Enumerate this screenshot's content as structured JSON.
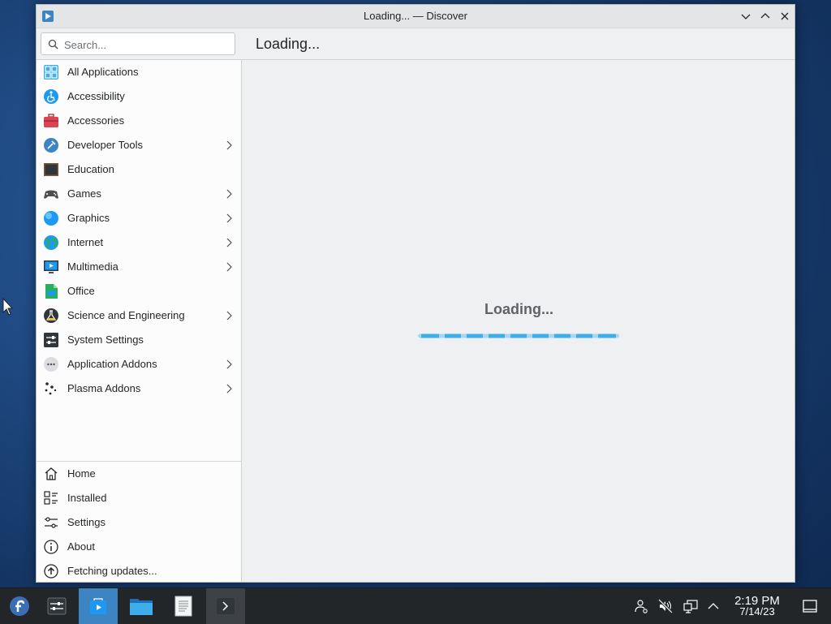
{
  "window": {
    "title": "Loading... — Discover"
  },
  "search": {
    "placeholder": "Search..."
  },
  "header": {
    "page_title": "Loading..."
  },
  "sidebar": {
    "categories": [
      {
        "label": "All Applications",
        "icon": "all-applications-icon",
        "submenu": false
      },
      {
        "label": "Accessibility",
        "icon": "accessibility-icon",
        "submenu": false
      },
      {
        "label": "Accessories",
        "icon": "accessories-icon",
        "submenu": false
      },
      {
        "label": "Developer Tools",
        "icon": "developer-tools-icon",
        "submenu": true
      },
      {
        "label": "Education",
        "icon": "education-icon",
        "submenu": false
      },
      {
        "label": "Games",
        "icon": "games-icon",
        "submenu": true
      },
      {
        "label": "Graphics",
        "icon": "graphics-icon",
        "submenu": true
      },
      {
        "label": "Internet",
        "icon": "internet-icon",
        "submenu": true
      },
      {
        "label": "Multimedia",
        "icon": "multimedia-icon",
        "submenu": true
      },
      {
        "label": "Office",
        "icon": "office-icon",
        "submenu": false
      },
      {
        "label": "Science and Engineering",
        "icon": "science-icon",
        "submenu": true
      },
      {
        "label": "System Settings",
        "icon": "system-settings-icon",
        "submenu": false
      },
      {
        "label": "Application Addons",
        "icon": "application-addons-icon",
        "submenu": true
      },
      {
        "label": "Plasma Addons",
        "icon": "plasma-addons-icon",
        "submenu": true
      }
    ],
    "bottom": [
      {
        "label": "Home",
        "icon": "home-icon"
      },
      {
        "label": "Installed",
        "icon": "installed-icon"
      },
      {
        "label": "Settings",
        "icon": "settings-icon"
      },
      {
        "label": "About",
        "icon": "about-icon"
      },
      {
        "label": "Fetching updates...",
        "icon": "update-icon"
      }
    ]
  },
  "content": {
    "loading_label": "Loading..."
  },
  "taskbar": {
    "time": "2:19 PM",
    "date": "7/14/23"
  },
  "colors": {
    "accent": "#3daee9",
    "taskbar": "#232629",
    "active_task": "#3d84c3"
  }
}
